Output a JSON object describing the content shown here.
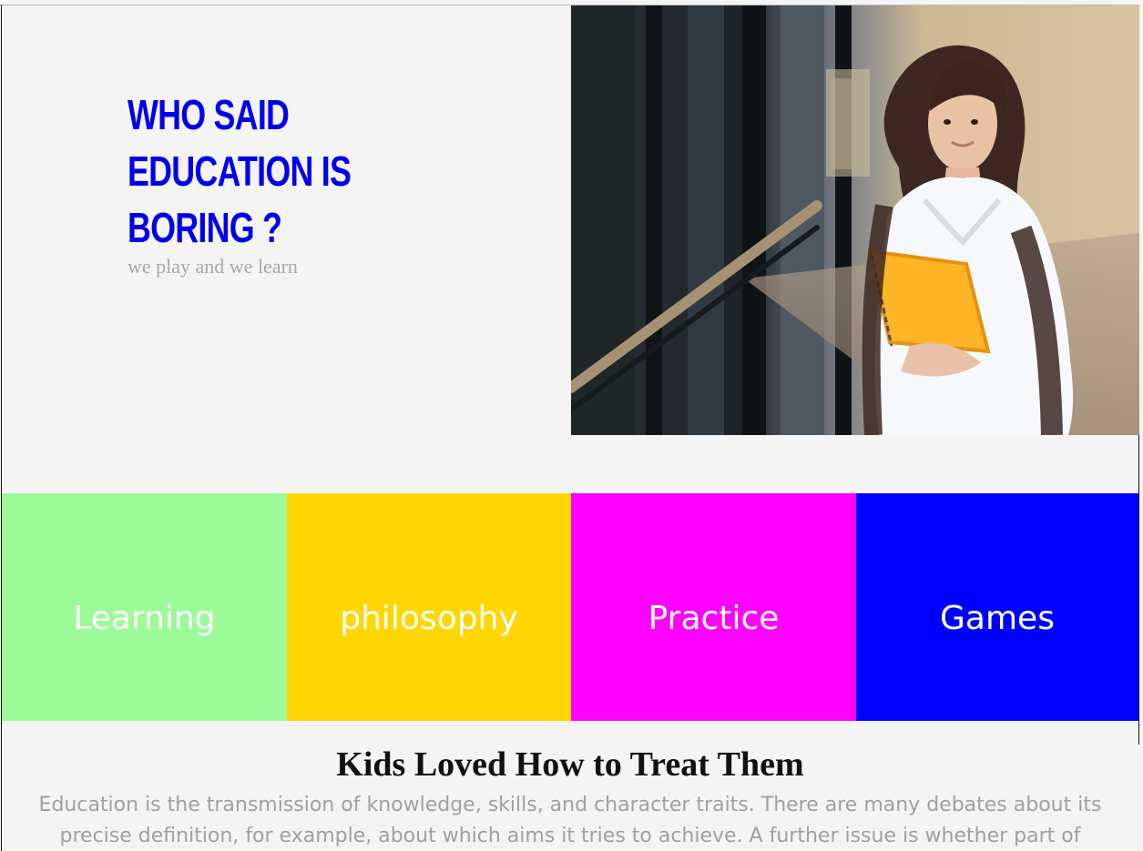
{
  "hero": {
    "title": "WHO SAID EDUCATION IS BORING ?",
    "subtitle": "we play and we learn",
    "image_icon": "student-photo"
  },
  "tiles": [
    {
      "label": "Learning",
      "color": "#9cfb98"
    },
    {
      "label": "philosophy",
      "color": "#ffd700"
    },
    {
      "label": "Practice",
      "color": "#ff00ff"
    },
    {
      "label": "Games",
      "color": "#0000ff"
    }
  ],
  "article": {
    "title": "Kids Loved How to Treat Them",
    "body": "Education is the transmission of knowledge, skills, and character traits. There are many debates about its precise definition, for example, about which aims it tries to achieve. A further issue is whether part of"
  },
  "colors": {
    "title_blue": "#0000ee",
    "subtitle_gray": "#a8a8a8",
    "body_gray": "#a0a0a0",
    "page_bg": "#f4f4f4"
  }
}
